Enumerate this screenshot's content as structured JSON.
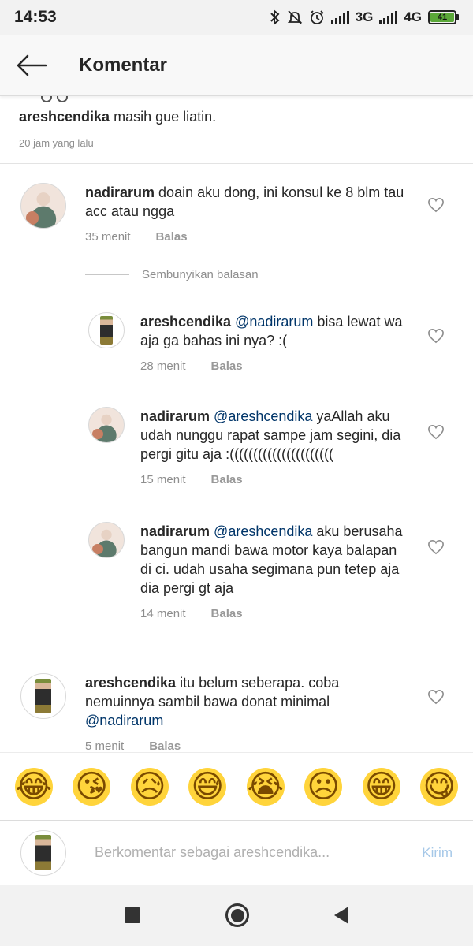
{
  "status_bar": {
    "time": "14:53",
    "network_3g": "3G",
    "network_4g": "4G",
    "battery": "41",
    "icons": [
      "bluetooth-icon",
      "mute-icon",
      "alarm-icon",
      "signal-icon",
      "signal-icon",
      "battery-icon"
    ]
  },
  "header": {
    "title": "Komentar",
    "back_icon": "arrow-left-icon"
  },
  "top_comment": {
    "username": "areshcendika",
    "text": "masih gue liatin.",
    "time": "20 jam yang lalu"
  },
  "comments": [
    {
      "username": "nadirarum",
      "text": "doain aku dong, ini konsul ke 8 blm tau acc atau ngga",
      "time": "35 menit",
      "reply_label": "Balas"
    },
    {
      "username": "areshcendika",
      "mention": "@nadirarum",
      "text": "bisa lewat wa aja ga bahas ini nya? :(",
      "time": "28 menit",
      "reply_label": "Balas"
    },
    {
      "username": "nadirarum",
      "mention": "@areshcendika",
      "text": "yaAllah aku udah nunggu rapat sampe jam segini, dia pergi gitu aja :((((((((((((((((((((((",
      "time": "15 menit",
      "reply_label": "Balas"
    },
    {
      "username": "nadirarum",
      "mention": "@areshcendika",
      "text": "aku berusaha bangun mandi bawa motor kaya balapan di ci. udah usaha segimana pun tetep aja dia pergi gt aja",
      "time": "14 menit",
      "reply_label": "Balas"
    },
    {
      "username": "areshcendika",
      "text": "itu belum seberapa. coba nemuinnya sambil bawa donat minimal",
      "mention": "@nadirarum",
      "time": "5 menit",
      "reply_label": "Balas"
    }
  ],
  "hide_replies_label": "Sembunyikan balasan",
  "emojis": [
    "😂",
    "😘",
    "😥",
    "😅",
    "😭",
    "☹",
    "😁",
    "😋"
  ],
  "input": {
    "placeholder": "Berkomentar sebagai areshcendika...",
    "send_label": "Kirim"
  },
  "colors": {
    "mention": "#003569",
    "meta": "#8e8e8e",
    "send_disabled": "#a6c8e8"
  }
}
